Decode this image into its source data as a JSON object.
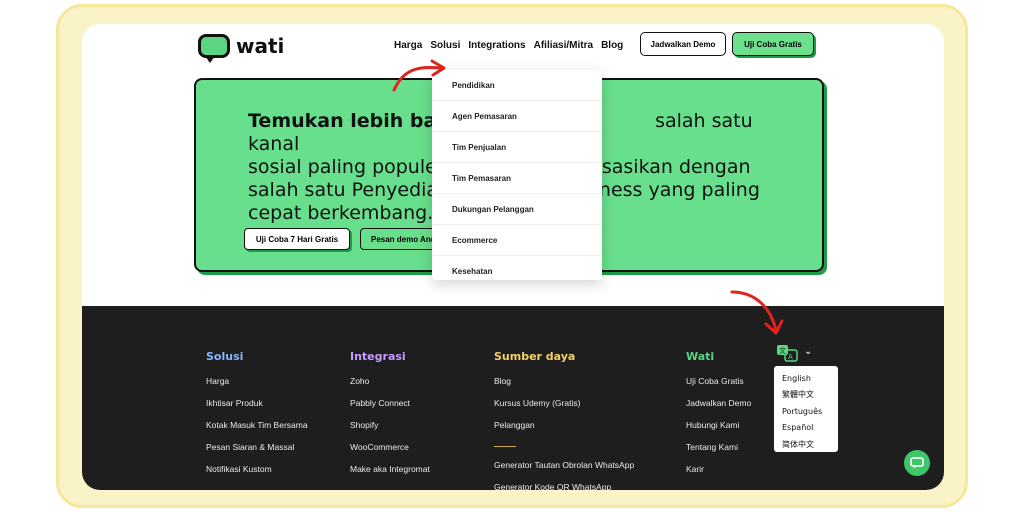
{
  "brand": {
    "name": "wati"
  },
  "nav": {
    "items": [
      "Harga",
      "Solusi",
      "Integrations",
      "Afiliasi/Mitra",
      "Blog"
    ],
    "demo_button": "Jadwalkan Demo",
    "trial_button": "Uji Coba Gratis"
  },
  "hero": {
    "text_bold": "Temukan lebih banya",
    "text_rest_line1": "salah satu kanal",
    "line2_left": "sosial paling populer s",
    "line2_right": "isasikan dengan",
    "line3_left": "salah satu Penyedia L",
    "line3_right": "Business yang paling",
    "line4": "cepat berkembang.",
    "button_trial": "Uji Coba 7 Hari Gratis",
    "button_demo": "Pesan demo Anda"
  },
  "dropdown": {
    "items": [
      "Pendidikan",
      "Agen Pemasaran",
      "Tim Penjualan",
      "Tim Pemasaran",
      "Dukungan Pelanggan",
      "Ecommerce",
      "Kesehatan"
    ]
  },
  "footer": {
    "columns": [
      {
        "title": "Solusi",
        "color": "#8ab4ff",
        "links": [
          "Harga",
          "Ikhtisar Produk",
          "Kotak Masuk Tim Bersama",
          "Pesan Siaran & Massal",
          "Notifikasi Kustom"
        ]
      },
      {
        "title": "Integrasi",
        "color": "#c79bff",
        "links": [
          "Zoho",
          "Pabbly Connect",
          "Shopify",
          "WooCommerce",
          "Make aka Integromat"
        ]
      },
      {
        "title": "Sumber daya",
        "color": "#f2d16b",
        "links": [
          "Blog",
          "Kursus Udemy (Gratis)",
          "Pelanggan"
        ],
        "links_after_divider": [
          "Generator Tautan Obrolan WhatsApp",
          "Generator Kode QR WhatsApp"
        ]
      },
      {
        "title": "Wati",
        "color": "#5bd582",
        "links": [
          "Uji Coba Gratis",
          "Jadwalkan Demo",
          "Hubungi Kami",
          "Tentang Kami",
          "Karir"
        ]
      }
    ],
    "languages": [
      "English",
      "繁體中文",
      "Português",
      "Español",
      "简体中文"
    ]
  },
  "colors": {
    "brand_green": "#68df8c",
    "footer_bg": "#1e1e1e",
    "frame": "#fbf3c8",
    "arrow": "#e0231c"
  }
}
